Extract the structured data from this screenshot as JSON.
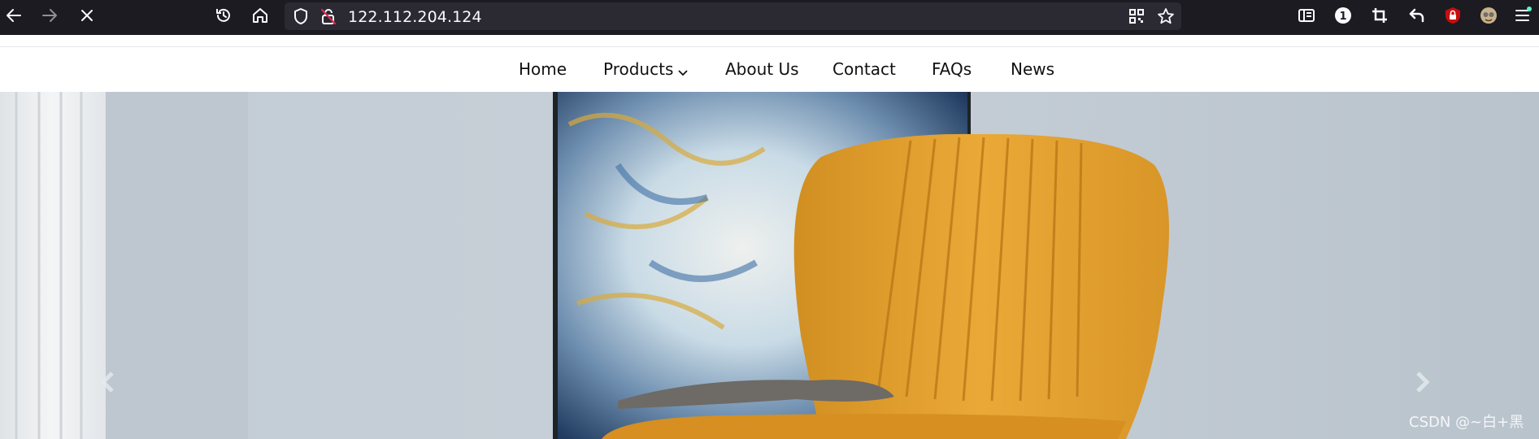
{
  "browser": {
    "url": "122.112.204.124",
    "icons": [
      "back-icon",
      "forward-icon",
      "stop-icon",
      "history-icon",
      "home-icon",
      "shield-icon",
      "insecure-lock-icon",
      "qr-code-icon",
      "bookmark-star-icon",
      "reader-view-icon",
      "extension-badge-icon",
      "crop-icon",
      "undo-icon",
      "ublock-icon",
      "avatar-icon",
      "menu-icon"
    ],
    "extension_badge_count": "1"
  },
  "nav": {
    "items": [
      {
        "label": "Home"
      },
      {
        "label": "Products",
        "has_dropdown": true
      },
      {
        "label": "About Us"
      },
      {
        "label": "Contact"
      },
      {
        "label": "FAQs"
      },
      {
        "label": "News"
      }
    ]
  },
  "hero": {
    "description_icons": [
      "chevron-left-icon",
      "chevron-right-icon"
    ],
    "colors": {
      "wall": "#c6ced6",
      "chair": "#e3a12e",
      "frame": "#1e2327"
    }
  },
  "watermark": "CSDN @~白+黑"
}
